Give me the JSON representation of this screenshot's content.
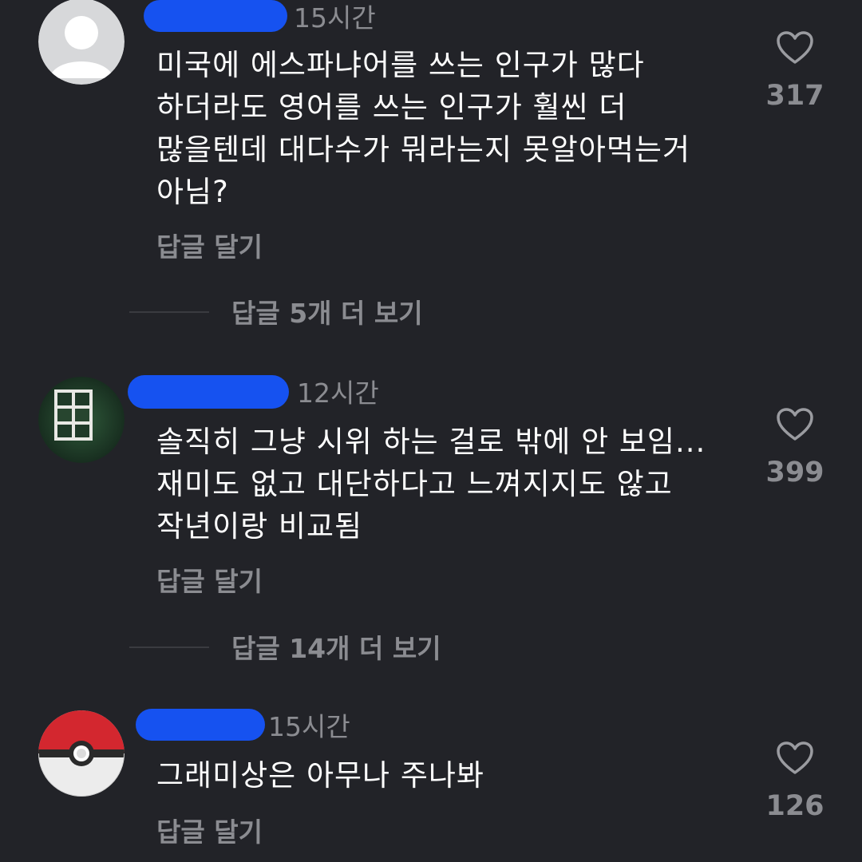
{
  "comments": [
    {
      "time": "15시간",
      "lines": [
        "미국에 에스파냐어를 쓰는 인구가 많다",
        "하더라도 영어를 쓰는 인구가 훨씬 더",
        "많을텐데 대다수가 뭐라는지 못알아먹는거",
        "아님?"
      ],
      "reply_label": "답글 달기",
      "likes": "317",
      "more_replies": "답글 5개 더 보기"
    },
    {
      "time": "12시간",
      "lines": [
        "솔직히 그냥 시위 하는 걸로 밖에 안 보임...",
        "재미도 없고 대단하다고 느껴지지도 않고",
        "작년이랑 비교됨"
      ],
      "reply_label": "답글 달기",
      "likes": "399",
      "more_replies": "답글 14개 더 보기"
    },
    {
      "time": "15시간",
      "lines": [
        "그래미상은 아무나  주나봐"
      ],
      "reply_label": "답글 달기",
      "likes": "126"
    }
  ],
  "icons": {
    "like": "heart-outline-icon",
    "avatar_1": "default-user-avatar",
    "avatar_2": "window-photo-avatar",
    "avatar_3": "pokeball-avatar"
  },
  "colors": {
    "background": "#222328",
    "redaction": "#1652f0",
    "muted_text": "#8b8c91",
    "primary_text": "#ffffff"
  }
}
